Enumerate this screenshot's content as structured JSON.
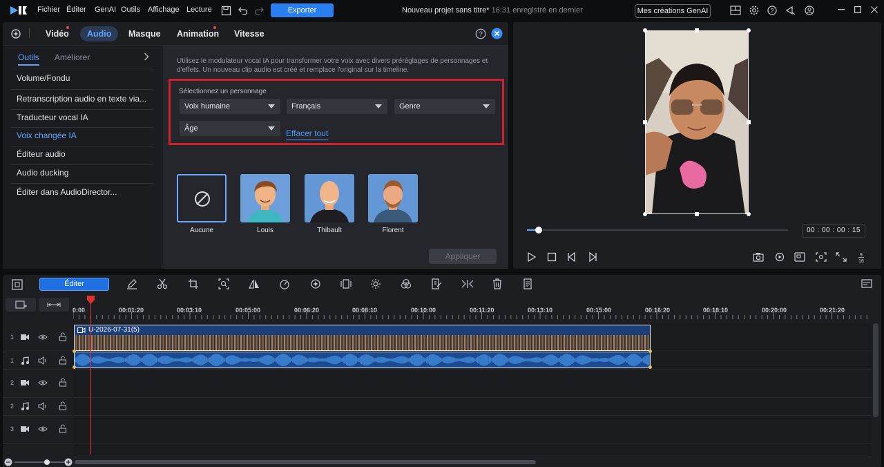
{
  "menu": [
    "Fichier",
    "Éditer",
    "GenAI",
    "Outils",
    "Affichage",
    "Lecture"
  ],
  "export_label": "Exporter",
  "project": {
    "title": "Nouveau projet sans titre*",
    "saved": "16:31 enregistré en dernier"
  },
  "genai_button": "Mes créations GenAI",
  "tabs": [
    "Vidéo",
    "Audio",
    "Masque",
    "Animation",
    "Vitesse"
  ],
  "subtabs": [
    "Outils",
    "Améliorer"
  ],
  "sidebar_items": [
    "Volume/Fondu",
    "Retranscription audio en texte via...",
    "Traducteur vocal IA",
    "Voix changée IA",
    "Éditeur audio",
    "Audio ducking",
    "Éditer dans AudioDirector..."
  ],
  "description": "Utilisez le modulateur vocal IA pour transformer votre voix avec divers préréglages de personnages et d'effets. Un nouveau clip audio est créé et remplace l'original sur la timeline.",
  "select_label": "Sélectionnez un personnage",
  "dropdowns": {
    "voice": "Voix humaine",
    "language": "Français",
    "gender": "Genre",
    "age": "Âge"
  },
  "clear_all": "Effacer tout",
  "characters": [
    "Aucune",
    "Louis",
    "Thibault",
    "Florent"
  ],
  "apply_label": "Appliquer",
  "timecode": "00 : 00 : 00 : 15",
  "timeline": {
    "edit_label": "Éditer",
    "ticks": [
      "0:00",
      "00:01:20",
      "00:03:10",
      "00:05:00",
      "00:06:20",
      "00:08:10",
      "00:10:00",
      "00:11:20",
      "00:13:10",
      "00:15:00",
      "00:16:20",
      "00:18:10",
      "00:20:00",
      "00:21:20"
    ],
    "clip_name": "U-2026-07-31(5)",
    "track_numbers": [
      "1",
      "1",
      "2",
      "2",
      "3"
    ]
  },
  "colors": {
    "accent": "#2a7ff0",
    "highlight": "#d0202a",
    "link": "#4e9bff"
  }
}
